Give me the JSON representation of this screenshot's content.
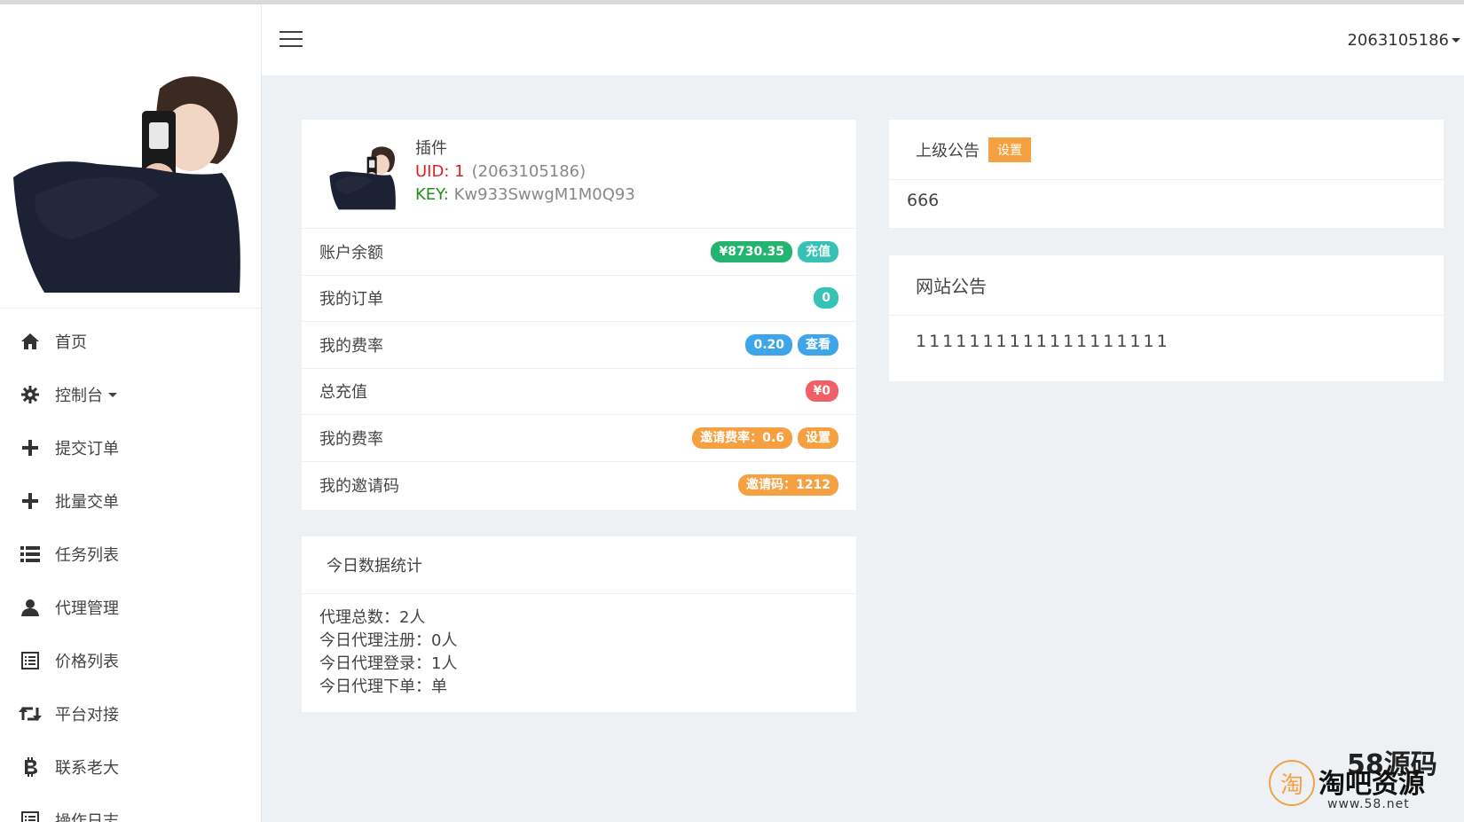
{
  "header": {
    "username": "2063105186"
  },
  "sidebar": {
    "items": [
      {
        "label": "首页",
        "icon": "home-icon"
      },
      {
        "label": "控制台",
        "icon": "gear-icon",
        "has_dropdown": true
      },
      {
        "label": "提交订单",
        "icon": "plus-icon"
      },
      {
        "label": "批量交单",
        "icon": "plus-icon"
      },
      {
        "label": "任务列表",
        "icon": "list-icon"
      },
      {
        "label": "代理管理",
        "icon": "user-icon"
      },
      {
        "label": "价格列表",
        "icon": "document-list-icon"
      },
      {
        "label": "平台对接",
        "icon": "retweet-icon"
      },
      {
        "label": "联系老大",
        "icon": "bitcoin-icon"
      },
      {
        "label": "操作日志",
        "icon": "document-list-icon"
      }
    ]
  },
  "profile": {
    "name": "插件",
    "uid_label": "UID: 1",
    "uid_qq": "(2063105186)",
    "key_label": "KEY:",
    "key_value": "Kw933SwwgM1M0Q93"
  },
  "stats": [
    {
      "label": "账户余额",
      "badges": [
        {
          "text": "¥8730.35",
          "color": "green"
        },
        {
          "text": "充值",
          "color": "teal"
        }
      ]
    },
    {
      "label": "我的订单",
      "badges": [
        {
          "text": "0",
          "color": "teal"
        }
      ]
    },
    {
      "label": "我的费率",
      "badges": [
        {
          "text": "0.20",
          "color": "blue"
        },
        {
          "text": "查看",
          "color": "blue"
        }
      ]
    },
    {
      "label": "总充值",
      "badges": [
        {
          "text": "¥0",
          "color": "red"
        }
      ]
    },
    {
      "label": "我的费率",
      "badges": [
        {
          "text": "邀请费率：0.6",
          "color": "orange"
        },
        {
          "text": "设置",
          "color": "orange"
        }
      ]
    },
    {
      "label": "我的邀请码",
      "badges": [
        {
          "text": "邀请码：1212",
          "color": "orange"
        }
      ]
    }
  ],
  "today": {
    "title": "今日数据统计",
    "lines": [
      "代理总数：2人",
      "今日代理注册：0人",
      "今日代理登录：1人",
      "今日代理下单：单"
    ]
  },
  "upper_notice": {
    "title": "上级公告",
    "button": "设置",
    "content": "666"
  },
  "site_notice": {
    "title": "网站公告",
    "content": "1111111111111111111"
  },
  "watermark": {
    "logo_char": "淘",
    "text_top": "58源码",
    "text_main": "淘吧资源",
    "url": "www.58.net"
  },
  "colors": {
    "green": "#23b46f",
    "teal": "#36c2b4",
    "blue": "#3fa5ea",
    "red": "#f06066",
    "orange": "#f5a142"
  }
}
